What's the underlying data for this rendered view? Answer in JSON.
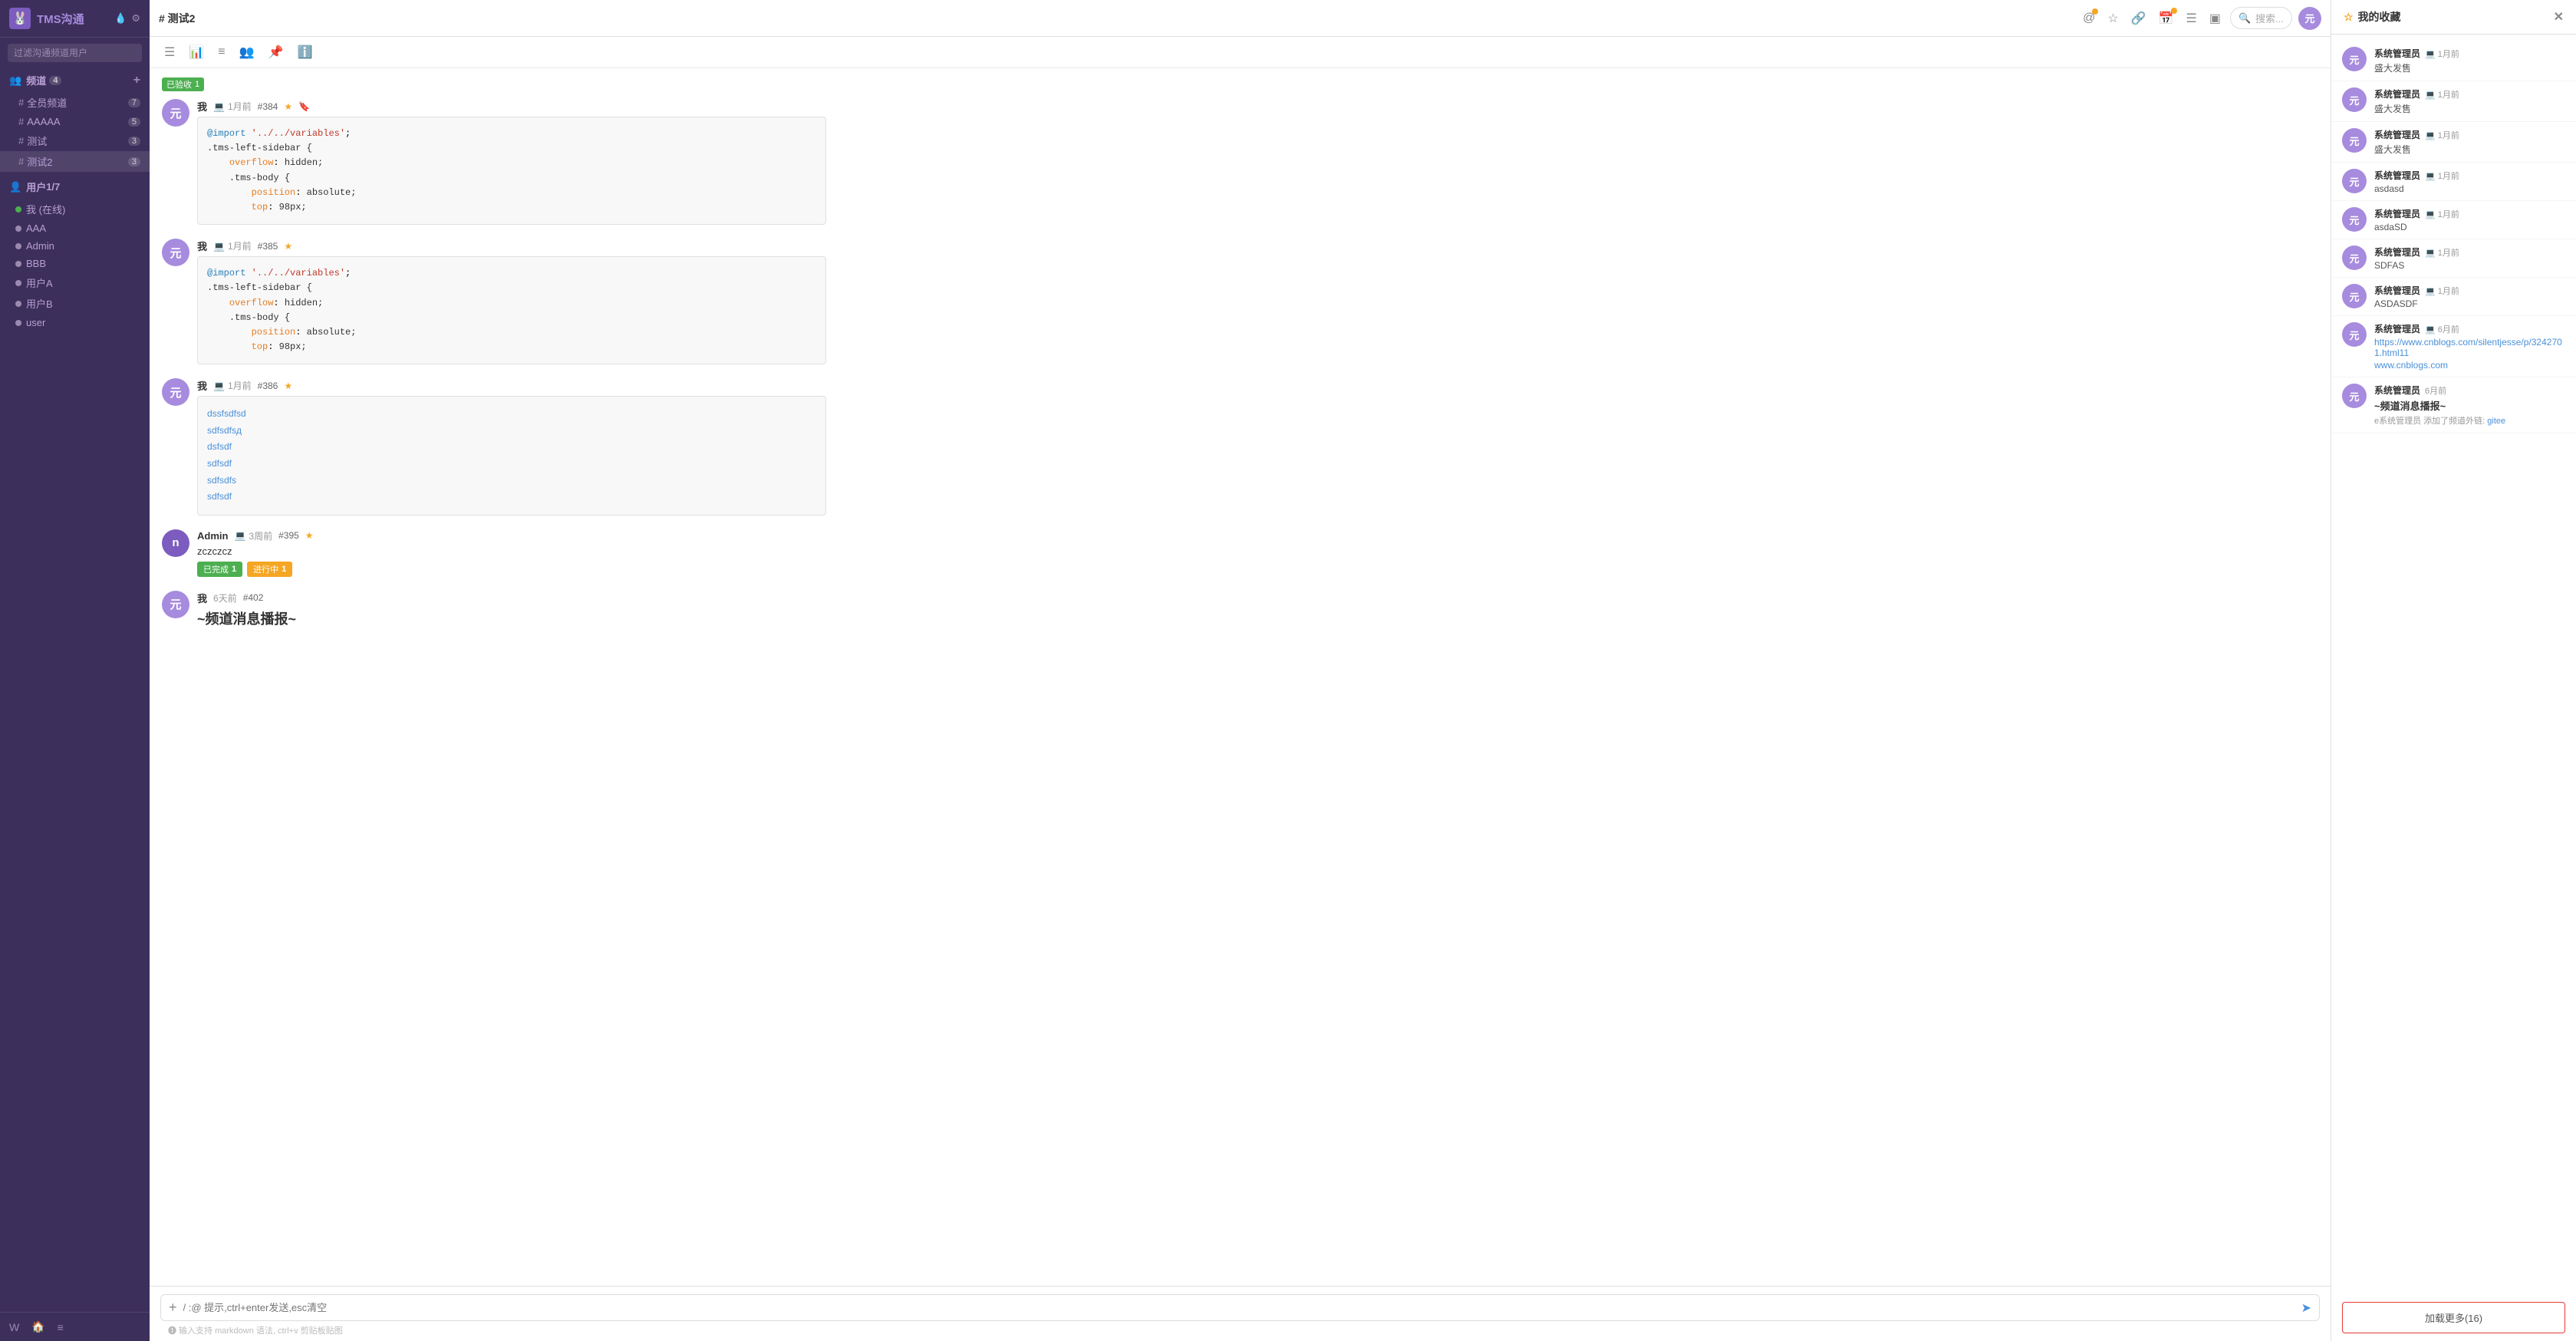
{
  "app": {
    "title": "TMS沟通",
    "logo_char": "🐰"
  },
  "sidebar": {
    "search_placeholder": "过滤沟通频道用户",
    "channels_section": {
      "label": "频道",
      "count": "4",
      "add_icon": "+"
    },
    "channel_items": [
      {
        "name": "全员频道",
        "count": "7"
      },
      {
        "name": "AAAAA",
        "count": "5"
      },
      {
        "name": "测试",
        "count": "3"
      },
      {
        "name": "测试2",
        "count": "3",
        "active": true
      }
    ],
    "users_section": {
      "label": "用户",
      "count": "1/7"
    },
    "user_items": [
      {
        "name": "我 (在线)",
        "online": true
      },
      {
        "name": "AAA",
        "online": false
      },
      {
        "name": "Admin",
        "online": false
      },
      {
        "name": "BBB",
        "online": false
      },
      {
        "name": "用户A",
        "online": false
      },
      {
        "name": "用户B",
        "online": false
      },
      {
        "name": "user",
        "online": false
      }
    ],
    "bottom_icons": [
      "W",
      "🏠",
      "≡"
    ]
  },
  "topbar": {
    "channel_title": "# 测试2",
    "icons": [
      "☰",
      "📊",
      "≡",
      "👥",
      "📌",
      "ℹ️"
    ],
    "search_placeholder": "搜索...",
    "avatar_char": "元"
  },
  "channel_toolbar": {
    "icons": [
      "☰",
      "📊",
      "≡",
      "👥",
      "📌",
      "ℹ️"
    ]
  },
  "messages": [
    {
      "id": "msg1",
      "verified_badge": "已验收",
      "verified_count": "1",
      "avatar_char": "元",
      "author": "我",
      "time": "1月前",
      "platform": "💻",
      "msg_id": "#384",
      "has_star": true,
      "has_bookmark": true,
      "type": "code",
      "code_lines": [
        {
          "type": "import",
          "text": "@import '../../variables';"
        },
        {
          "type": "selector",
          "text": ".tms-left-sidebar {"
        },
        {
          "type": "property",
          "text": "    overflow: hidden;"
        },
        {
          "type": "selector",
          "text": "    .tms-body {"
        },
        {
          "type": "property",
          "text": "        position: absolute;"
        },
        {
          "type": "property",
          "text": "        top: 98px;"
        }
      ]
    },
    {
      "id": "msg2",
      "avatar_char": "元",
      "author": "我",
      "time": "1月前",
      "platform": "💻",
      "msg_id": "#385",
      "has_star": true,
      "has_bookmark": false,
      "type": "code",
      "code_lines": [
        {
          "type": "import",
          "text": "@import '../../variables';"
        },
        {
          "type": "selector",
          "text": ".tms-left-sidebar {"
        },
        {
          "type": "property",
          "text": "    overflow: hidden;"
        },
        {
          "type": "selector",
          "text": "    .tms-body {"
        },
        {
          "type": "property",
          "text": "        position: absolute;"
        },
        {
          "type": "property",
          "text": "        top: 98px;"
        }
      ]
    },
    {
      "id": "msg3",
      "avatar_char": "元",
      "author": "我",
      "time": "1月前",
      "platform": "💻",
      "msg_id": "#386",
      "has_star": true,
      "has_bookmark": false,
      "type": "text",
      "text_lines": [
        "dssfsdfsd",
        "sdfsdfsд",
        "dsfsdf",
        "sdfsdf",
        "sdfsdfs",
        "sdfsdf"
      ]
    },
    {
      "id": "msg4",
      "avatar_char": "n",
      "avatar_class": "admin-n",
      "author": "Admin",
      "time": "3周前",
      "platform": "💻",
      "msg_id": "#395",
      "has_star": true,
      "has_bookmark": false,
      "type": "plain",
      "text": "zczczcz",
      "badges": [
        {
          "type": "done",
          "label": "已完成",
          "count": "1"
        },
        {
          "type": "progress",
          "label": "进行中",
          "count": "1"
        }
      ]
    },
    {
      "id": "msg5",
      "avatar_char": "元",
      "author": "我",
      "time": "6天前",
      "platform": "",
      "msg_id": "#402",
      "has_star": false,
      "has_bookmark": false,
      "type": "bold",
      "text": "~频道消息播报~"
    }
  ],
  "input": {
    "placeholder": "/ :@ 提示,ctrl+enter发送,esc清空",
    "hint": "❶ 输入支持 markdown 语法, ctrl+v 剪贴板贴图"
  },
  "bookmarks": {
    "title": "我的收藏",
    "items": [
      {
        "avatar_char": "元",
        "author": "系统管理员",
        "time": "1月前",
        "platform": "💻",
        "text": "盛大发售"
      },
      {
        "avatar_char": "元",
        "author": "系统管理员",
        "time": "1月前",
        "platform": "💻",
        "text": "盛大发售"
      },
      {
        "avatar_char": "元",
        "author": "系统管理员",
        "time": "1月前",
        "platform": "💻",
        "text": "盛大发售"
      },
      {
        "avatar_char": "元",
        "author": "系统管理员",
        "time": "1月前",
        "platform": "💻",
        "text": "asdasd"
      },
      {
        "avatar_char": "元",
        "author": "系统管理员",
        "time": "1月前",
        "platform": "💻",
        "text": "asdaSD"
      },
      {
        "avatar_char": "元",
        "author": "系统管理员",
        "time": "1月前",
        "platform": "💻",
        "text": "SDFAS"
      },
      {
        "avatar_char": "元",
        "author": "系统管理员",
        "time": "1月前",
        "platform": "💻",
        "text": "ASDASDF"
      },
      {
        "avatar_char": "元",
        "author": "系统管理员",
        "time": "6月前",
        "platform": "💻",
        "text": "https://www.cnblogs.com/silentjesse/p/3242701.html11",
        "type": "link"
      },
      {
        "avatar_char": "元",
        "author": "系统管理员",
        "time": "6月前",
        "platform": "",
        "text": "~频道消息播报~",
        "type": "bold",
        "sub_text": "e系统管理员 添加了频道外链: gitee"
      }
    ],
    "load_more_label": "加载更多(16)"
  }
}
